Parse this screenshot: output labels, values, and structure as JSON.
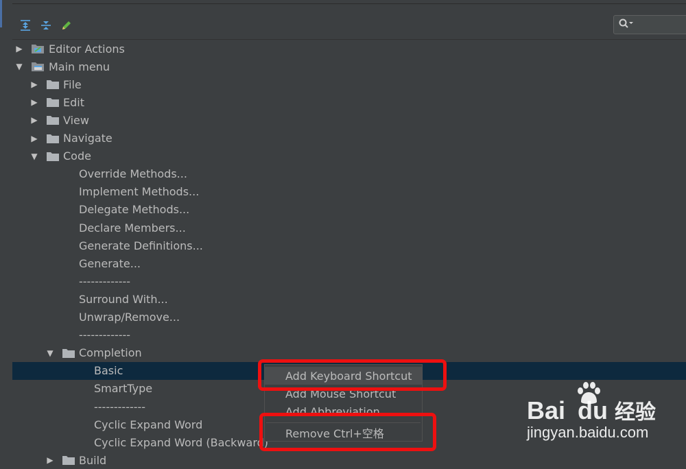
{
  "toolbar": {
    "buttons": [
      {
        "name": "expand-all-icon"
      },
      {
        "name": "collapse-all-icon"
      },
      {
        "name": "edit-pencil-icon"
      }
    ]
  },
  "search": {
    "icon": "search-icon",
    "value": ""
  },
  "tree": {
    "rows": [
      {
        "label": "Editor Actions",
        "arrow": "right",
        "icon": "editor-actions-icon"
      },
      {
        "label": "Main menu",
        "arrow": "down",
        "icon": "main-menu-icon"
      },
      {
        "label": "File",
        "arrow": "right",
        "icon": "folder-icon"
      },
      {
        "label": "Edit",
        "arrow": "right",
        "icon": "folder-icon"
      },
      {
        "label": "View",
        "arrow": "right",
        "icon": "folder-icon"
      },
      {
        "label": "Navigate",
        "arrow": "right",
        "icon": "folder-icon"
      },
      {
        "label": "Code",
        "arrow": "down",
        "icon": "folder-icon"
      },
      {
        "label": "Override Methods..."
      },
      {
        "label": "Implement Methods..."
      },
      {
        "label": "Delegate Methods..."
      },
      {
        "label": "Declare Members..."
      },
      {
        "label": "Generate Definitions..."
      },
      {
        "label": "Generate..."
      },
      {
        "label": "-------------"
      },
      {
        "label": "Surround With..."
      },
      {
        "label": "Unwrap/Remove..."
      },
      {
        "label": "-------------"
      },
      {
        "label": "Completion",
        "arrow": "down",
        "icon": "folder-icon"
      },
      {
        "label": "Basic",
        "selected": true
      },
      {
        "label": "SmartType"
      },
      {
        "label": "-------------"
      },
      {
        "label": "Cyclic Expand Word"
      },
      {
        "label": "Cyclic Expand Word (Backward)"
      },
      {
        "label": "Build",
        "arrow": "right",
        "icon": "folder-icon"
      }
    ]
  },
  "context_menu": {
    "items": [
      {
        "label": "Add Keyboard Shortcut",
        "highlighted": true
      },
      {
        "label": "Add Mouse Shortcut"
      },
      {
        "label": "Add Abbreviation"
      },
      {
        "label": "Remove Ctrl+空格"
      }
    ]
  },
  "watermark": {
    "brand_left": "Bai",
    "brand_right": "du",
    "brand_cn": "经验",
    "url": "jingyan.baidu.com"
  },
  "colors": {
    "background": "#3c3f41",
    "selection": "#0d293e",
    "annotation_red": "#ee1010",
    "text": "#bbbbbb"
  }
}
